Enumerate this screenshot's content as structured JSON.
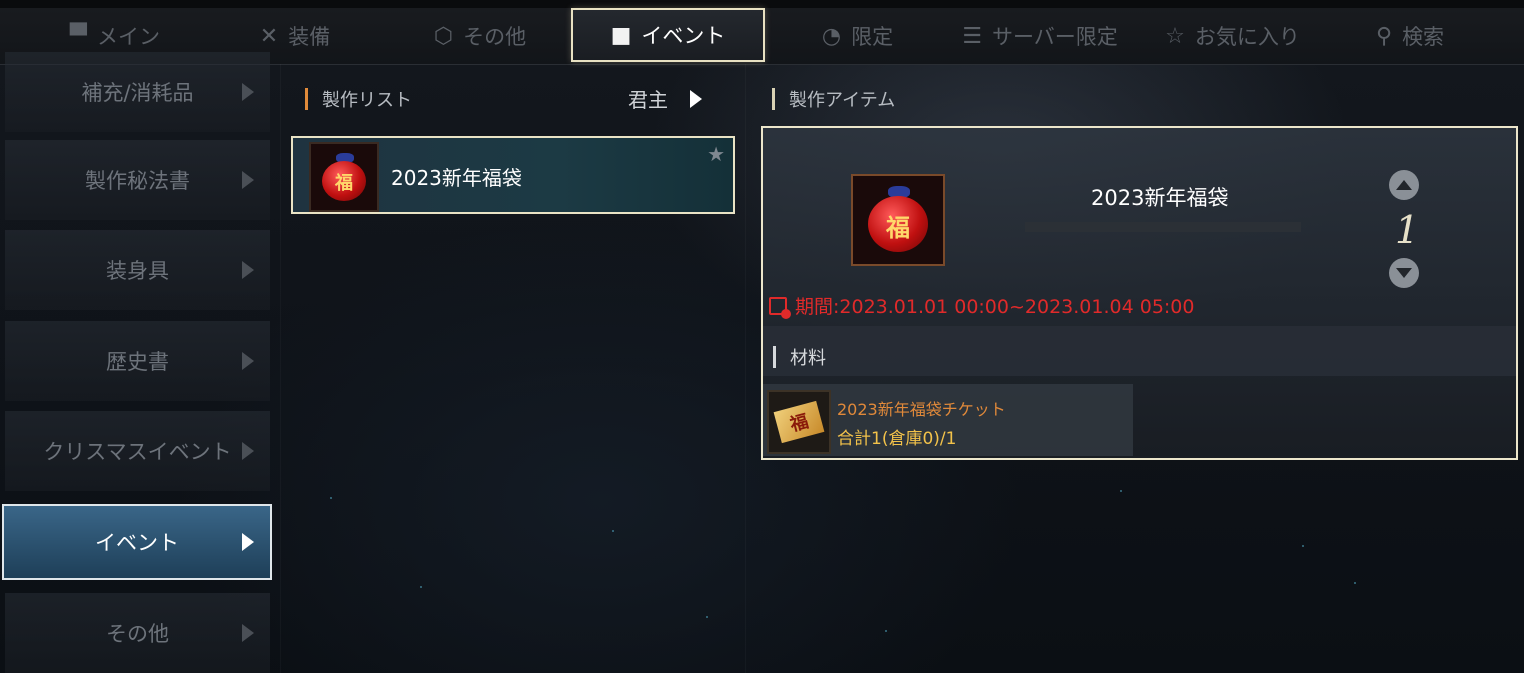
{
  "tabs": [
    {
      "label": "メイン",
      "icon": "anvil-icon"
    },
    {
      "label": "装備",
      "icon": "crossed-swords-icon"
    },
    {
      "label": "その他",
      "icon": "box-icon"
    },
    {
      "label": "イベント",
      "icon": "gift-icon",
      "active": true
    },
    {
      "label": "限定",
      "icon": "stopwatch-icon"
    },
    {
      "label": "サーバー限定",
      "icon": "list-clock-icon"
    },
    {
      "label": "お気に入り",
      "icon": "star-outline-icon"
    },
    {
      "label": "検索",
      "icon": "search-icon"
    }
  ],
  "sidebar": {
    "items": [
      {
        "label": "補充/消耗品"
      },
      {
        "label": "製作秘法書"
      },
      {
        "label": "装身具"
      },
      {
        "label": "歴史書"
      },
      {
        "label": "クリスマスイベント"
      },
      {
        "label": "イベント",
        "active": true
      },
      {
        "label": "その他"
      }
    ]
  },
  "craft_list": {
    "header": "製作リスト",
    "filter": "君主",
    "items": [
      {
        "name": "2023新年福袋",
        "icon_char": "福",
        "favorite": false
      }
    ]
  },
  "craft_item": {
    "header": "製作アイテム",
    "name": "2023新年福袋",
    "icon_char": "福",
    "quantity": "1",
    "period": "期間:2023.01.01  00:00~2023.01.04  05:00",
    "materials_label": "材料",
    "materials": [
      {
        "name": "2023新年福袋チケット",
        "count": "合計1(倉庫0)/1",
        "icon_char": "福"
      }
    ]
  },
  "colors": {
    "accent_orange": "#e08a3a",
    "period_red": "#e02a2a",
    "material_count_yellow": "#f2c24a",
    "active_blue": "#2e5a7a"
  }
}
